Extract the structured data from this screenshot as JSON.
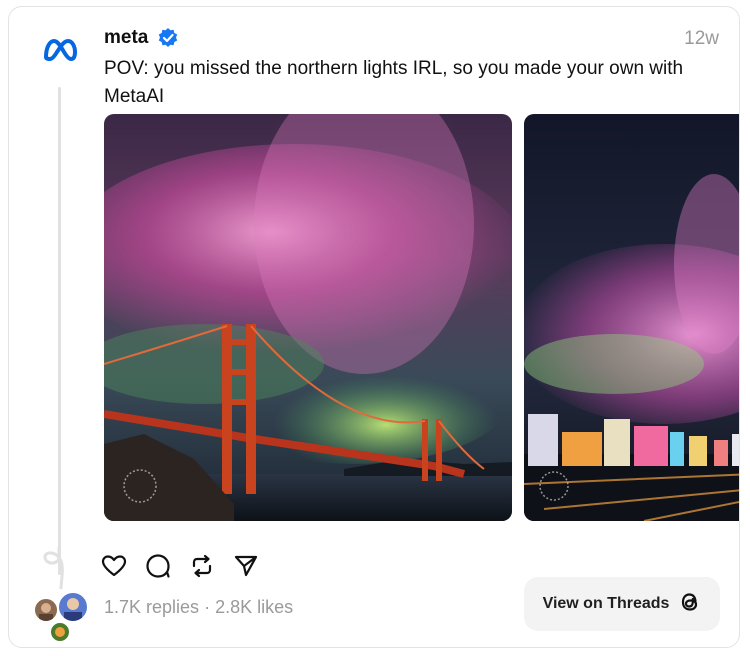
{
  "post": {
    "author": "meta",
    "timestamp": "12w",
    "text": "POV: you missed the northern lights IRL, so you made your own with MetaAI"
  },
  "stats": {
    "replies": "1.7K replies",
    "separator": " · ",
    "likes": "2.8K likes"
  },
  "cta": {
    "label": "View on Threads"
  },
  "icons": [
    "meta-logo-icon",
    "verified-badge-icon",
    "heart-icon",
    "comment-icon",
    "repost-icon",
    "share-icon",
    "threads-logo-icon"
  ],
  "colors": {
    "brand": "#0668E1",
    "verified": "#1877F2",
    "muted": "#9a9a9a",
    "button_bg": "#f3f3f3"
  }
}
